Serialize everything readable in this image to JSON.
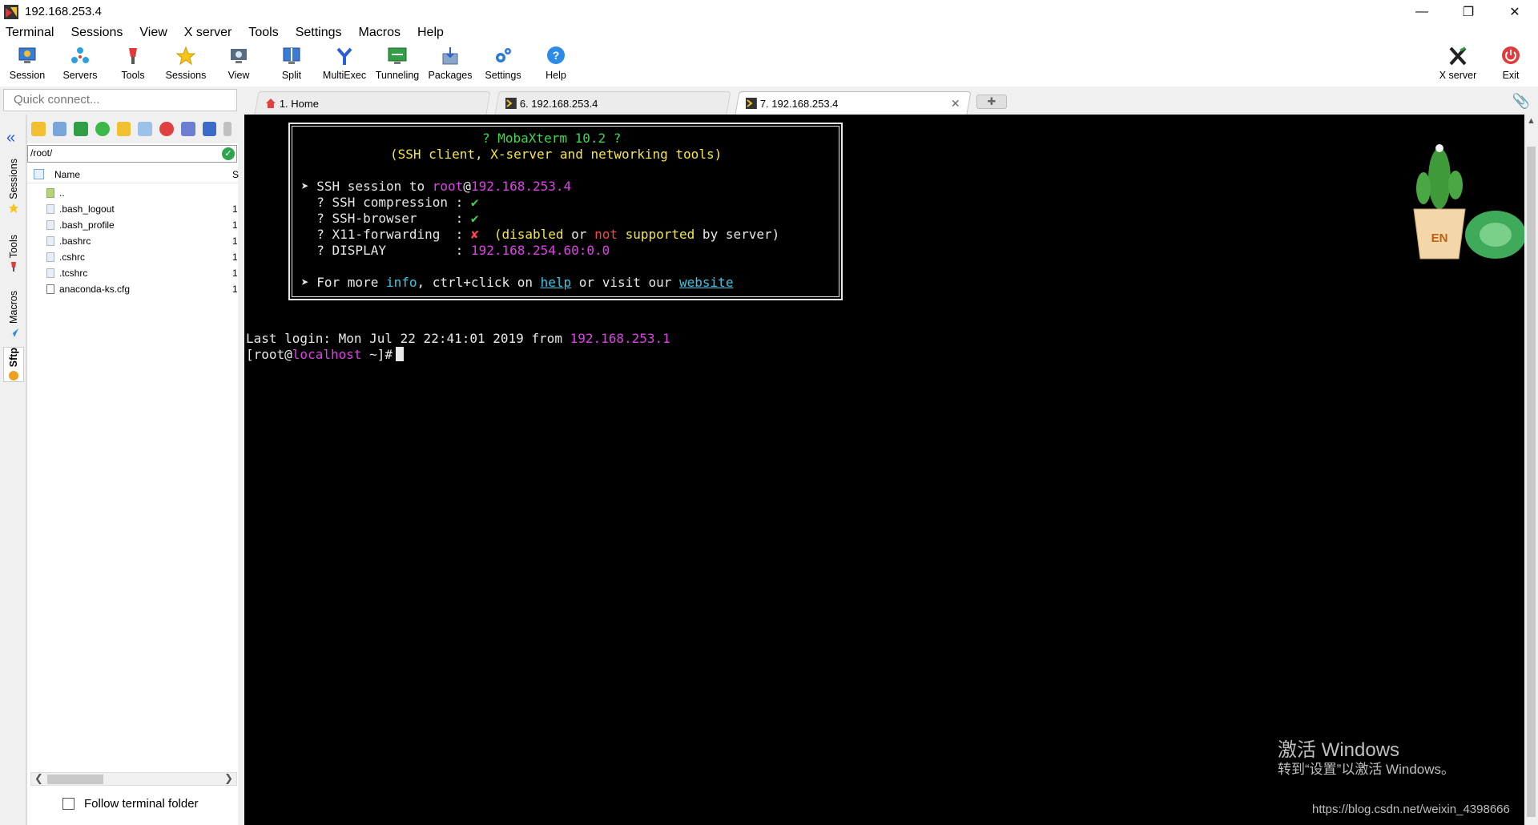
{
  "window": {
    "title": "192.168.253.4"
  },
  "menu": [
    "Terminal",
    "Sessions",
    "View",
    "X server",
    "Tools",
    "Settings",
    "Macros",
    "Help"
  ],
  "toolbar": {
    "session": "Session",
    "servers": "Servers",
    "tools": "Tools",
    "sessions": "Sessions",
    "view": "View",
    "split": "Split",
    "multiexec": "MultiExec",
    "tunneling": "Tunneling",
    "packages": "Packages",
    "settings": "Settings",
    "help": "Help",
    "xserver": "X server",
    "exit": "Exit"
  },
  "quick_connect": {
    "placeholder": "Quick connect..."
  },
  "tabs": [
    {
      "label": "1. Home"
    },
    {
      "label": "6. 192.168.253.4"
    },
    {
      "label": "7. 192.168.253.4"
    }
  ],
  "side_tabs": {
    "sessions": "Sessions",
    "tools": "Tools",
    "macros": "Macros",
    "sftp": "Sftp"
  },
  "sftp": {
    "path": "/root/",
    "col_name": "Name",
    "col_size": "S",
    "files": [
      {
        "name": "..",
        "size": ""
      },
      {
        "name": ".bash_logout",
        "size": "1"
      },
      {
        "name": ".bash_profile",
        "size": "1"
      },
      {
        "name": ".bashrc",
        "size": "1"
      },
      {
        "name": ".cshrc",
        "size": "1"
      },
      {
        "name": ".tcshrc",
        "size": "1"
      },
      {
        "name": "anaconda-ks.cfg",
        "size": "1"
      }
    ],
    "follow_label": "Follow terminal folder"
  },
  "terminal": {
    "banner_title": "? MobaXterm 10.2 ?",
    "banner_subtitle": "(SSH client, X-server and networking tools)",
    "session_prefix": "➤ SSH session to ",
    "user": "root",
    "at": "@",
    "host": "192.168.253.4",
    "compression_label": "  ? SSH compression : ",
    "compression_value": "✔",
    "browser_label": "  ? SSH-browser     : ",
    "browser_value": "✔",
    "x11_label": "  ? X11-forwarding  : ",
    "x11_value": "✘",
    "x11_open": "  (disabled ",
    "x11_or": "or ",
    "x11_not": "not ",
    "x11_supported": "supported",
    "x11_by": " by server)",
    "display_label": "  ? DISPLAY         : ",
    "display_value": "192.168.254.60:0.0",
    "more_prefix": "➤ For more ",
    "more_info": "info",
    "more_mid": ", ctrl+click on ",
    "more_help": "help",
    "more_mid2": " or visit our ",
    "more_website": "website",
    "last_login": "Last login: Mon Jul 22 22:41:01 2019 from ",
    "last_login_ip": "192.168.253.1",
    "prompt_open": "[root@",
    "prompt_host": "localhost",
    "prompt_close": " ~]#"
  },
  "plant_badge": "EN",
  "watermark": {
    "activate_title": "激活 Windows",
    "activate_sub": "转到“设置”以激活 Windows。",
    "csdn": "https://blog.csdn.net/weixin_4398666"
  },
  "colors": {
    "accent": "#2c5fd6",
    "terminal_bg": "#000000",
    "yellow": "#f4e84a",
    "magenta": "#e040e8",
    "green": "#3cd84a",
    "red": "#ff4545",
    "cyan": "#38c8e8"
  }
}
